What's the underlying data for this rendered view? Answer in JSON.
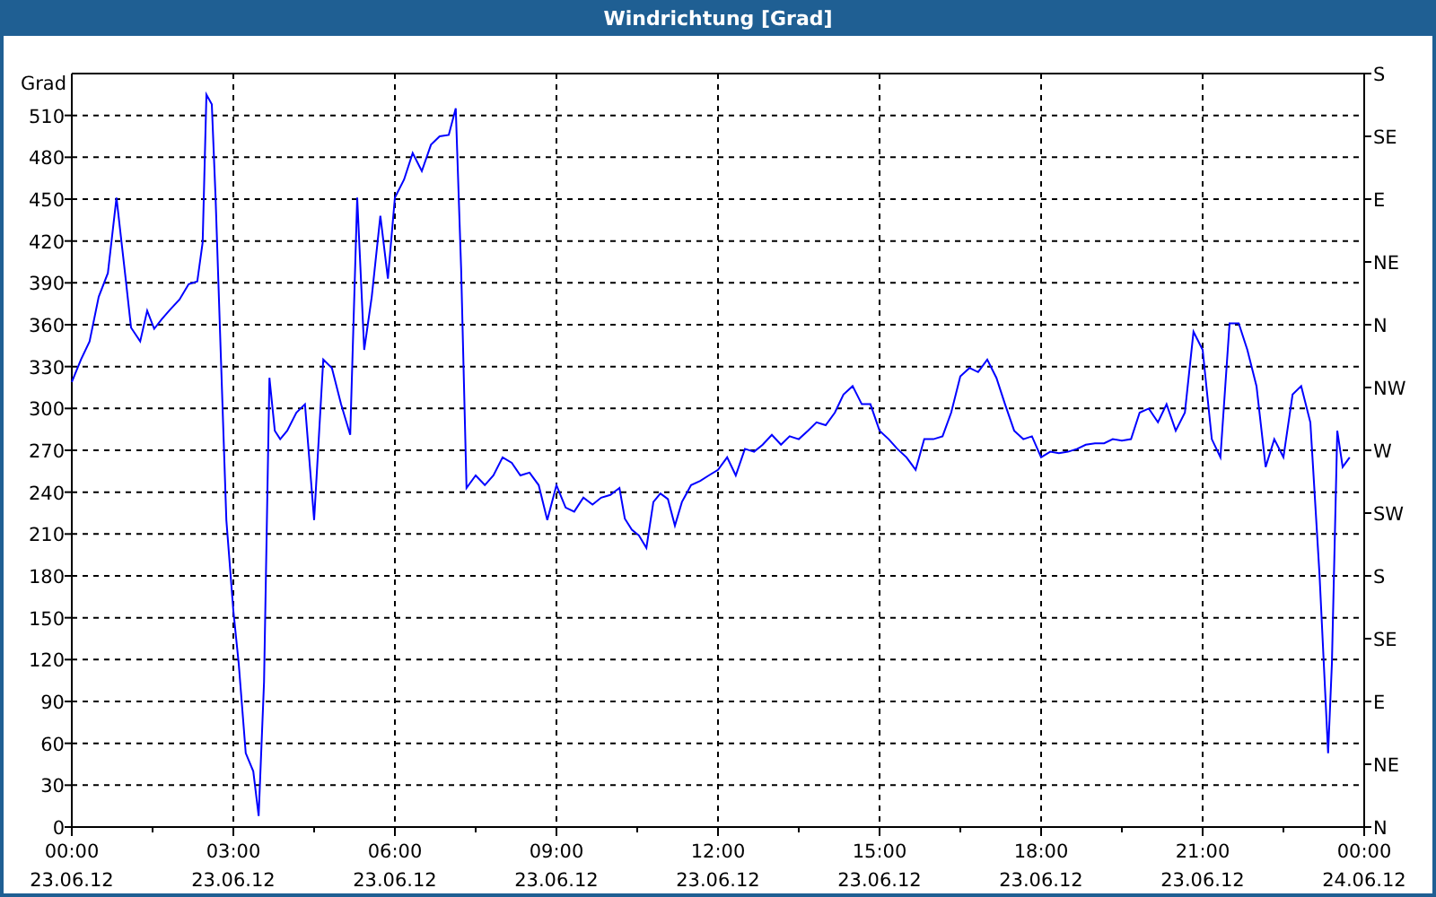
{
  "window": {
    "title": "Windrichtung [Grad]"
  },
  "time_axis": {
    "dates": [
      "23.06.12",
      "23.06.12",
      "23.06.12",
      "23.06.12",
      "23.06.12",
      "23.06.12",
      "23.06.12",
      "23.06.12",
      "24.06.12"
    ]
  },
  "direction_axis": {
    "labels": [
      "S",
      "SE",
      "E",
      "NE",
      "N",
      "NW",
      "W",
      "SW",
      "S",
      "SE",
      "E",
      "NE",
      "N"
    ]
  },
  "chart_data": {
    "type": "line",
    "ylabel": "Grad",
    "xlim": [
      0,
      24
    ],
    "ylim": [
      0,
      540
    ],
    "yticks": [
      0,
      30,
      60,
      90,
      120,
      150,
      180,
      210,
      240,
      270,
      300,
      330,
      360,
      390,
      420,
      450,
      480,
      510
    ],
    "grid": true,
    "xticks": [
      {
        "value": 0,
        "label": "00:00"
      },
      {
        "value": 3,
        "label": "03:00"
      },
      {
        "value": 6,
        "label": "06:00"
      },
      {
        "value": 9,
        "label": "09:00"
      },
      {
        "value": 12,
        "label": "12:00"
      },
      {
        "value": 15,
        "label": "15:00"
      },
      {
        "value": 18,
        "label": "18:00"
      },
      {
        "value": 21,
        "label": "21:00"
      },
      {
        "value": 24,
        "label": "00:00"
      }
    ],
    "x": [
      0,
      0.17,
      0.33,
      0.5,
      0.67,
      0.83,
      1,
      1.1,
      1.27,
      1.4,
      1.53,
      1.67,
      1.83,
      2,
      2.17,
      2.33,
      2.43,
      2.5,
      2.6,
      2.67,
      2.77,
      2.87,
      3,
      3.1,
      3.23,
      3.37,
      3.47,
      3.57,
      3.67,
      3.77,
      3.87,
      4,
      4.17,
      4.33,
      4.5,
      4.67,
      4.83,
      5,
      5.17,
      5.3,
      5.43,
      5.57,
      5.73,
      5.87,
      6,
      6.17,
      6.33,
      6.5,
      6.67,
      6.83,
      7,
      7.13,
      7.23,
      7.33,
      7.5,
      7.67,
      7.83,
      8,
      8.17,
      8.33,
      8.5,
      8.67,
      8.83,
      9,
      9.17,
      9.33,
      9.5,
      9.67,
      9.83,
      10,
      10.17,
      10.27,
      10.4,
      10.53,
      10.67,
      10.8,
      10.93,
      11.07,
      11.2,
      11.33,
      11.5,
      11.67,
      11.83,
      12,
      12.17,
      12.33,
      12.5,
      12.67,
      12.83,
      13,
      13.17,
      13.33,
      13.5,
      13.67,
      13.83,
      14,
      14.17,
      14.33,
      14.5,
      14.67,
      14.83,
      15,
      15.17,
      15.33,
      15.5,
      15.67,
      15.83,
      16,
      16.17,
      16.33,
      16.5,
      16.67,
      16.83,
      17,
      17.17,
      17.33,
      17.5,
      17.67,
      17.83,
      18,
      18.17,
      18.33,
      18.5,
      18.67,
      18.83,
      19,
      19.17,
      19.33,
      19.5,
      19.67,
      19.83,
      20,
      20.17,
      20.33,
      20.5,
      20.67,
      20.83,
      21,
      21.17,
      21.33,
      21.5,
      21.67,
      21.83,
      22,
      22.17,
      22.33,
      22.5,
      22.67,
      22.83,
      23,
      23.17,
      23.33,
      23.4,
      23.5,
      23.6,
      23.73
    ],
    "series": [
      {
        "color": "#0000ff",
        "values": [
          319,
          335,
          348,
          380,
          397,
          451,
          393,
          358,
          348,
          370,
          357,
          364,
          371,
          378,
          389,
          391,
          419,
          525,
          518,
          451,
          335,
          220,
          155,
          117,
          53,
          40,
          8,
          104,
          322,
          284,
          278,
          284,
          297,
          303,
          220,
          335,
          329,
          303,
          281,
          451,
          342,
          380,
          438,
          393,
          451,
          464,
          483,
          470,
          489,
          495,
          496,
          515,
          400,
          243,
          252,
          245,
          252,
          265,
          261,
          252,
          254,
          245,
          220,
          245,
          229,
          226,
          236,
          231,
          236,
          238,
          243,
          221,
          213,
          209,
          200,
          233,
          239,
          235,
          216,
          233,
          245,
          248,
          252,
          256,
          265,
          252,
          271,
          269,
          274,
          281,
          274,
          280,
          278,
          284,
          290,
          288,
          297,
          310,
          316,
          303,
          303,
          284,
          278,
          271,
          265,
          256,
          278,
          278,
          280,
          297,
          323,
          329,
          326,
          335,
          322,
          303,
          284,
          278,
          280,
          265,
          269,
          268,
          269,
          271,
          274,
          275,
          275,
          278,
          277,
          278,
          297,
          300,
          290,
          303,
          284,
          297,
          355,
          342,
          278,
          265,
          361,
          361,
          342,
          316,
          258,
          278,
          265,
          310,
          316,
          290,
          181,
          53,
          117,
          284,
          258,
          265
        ]
      }
    ]
  }
}
